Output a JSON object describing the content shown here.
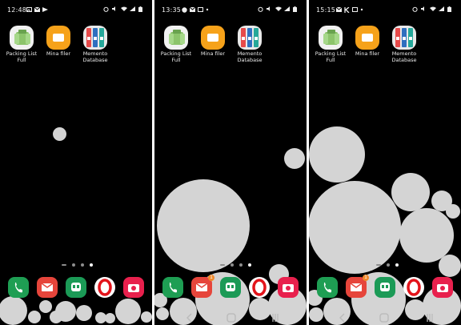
{
  "screens": [
    {
      "time": "12:48"
    },
    {
      "time": "13:35"
    },
    {
      "time": "15:15"
    }
  ],
  "apps": {
    "packing_list": "Packing List Full",
    "packing_list_l1": "Packing List",
    "packing_list_l2": "Full",
    "files": "Mina filer",
    "memento": "Memento Database",
    "memento_l1": "Memento",
    "memento_l2": "Database"
  },
  "dock": {
    "phone": "phone-app",
    "messages": "messages-app",
    "hangouts": "hangouts-app",
    "opera": "opera-browser",
    "camera": "camera-app",
    "messages_badge": "1"
  },
  "colors": {
    "background": "#000000",
    "bubble": "#d4d4d4",
    "phone_green": "#1e9e53",
    "messages_red": "#e6453b",
    "hangouts_green": "#1b9a56",
    "opera_red": "#e3141b",
    "camera_pink": "#e8204d",
    "files_orange": "#f6a21a"
  }
}
